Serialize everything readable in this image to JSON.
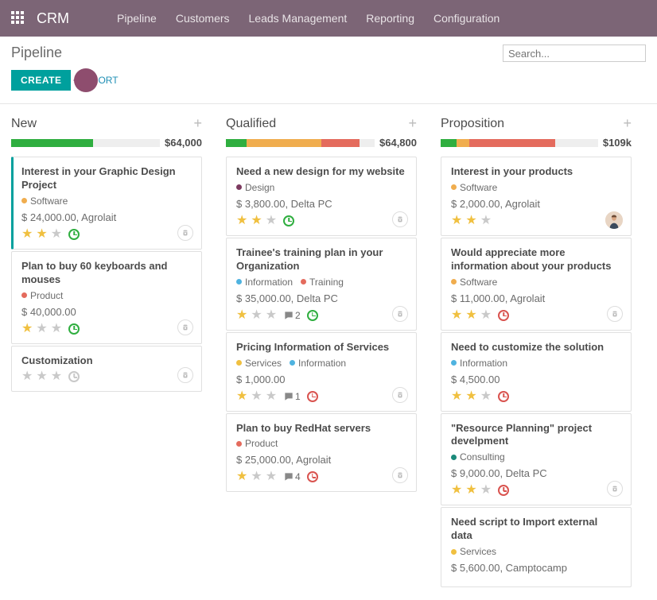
{
  "nav": {
    "brand": "CRM",
    "links": [
      "Pipeline",
      "Customers",
      "Leads Management",
      "Reporting",
      "Configuration"
    ]
  },
  "page": {
    "title": "Pipeline",
    "search_placeholder": "Search..."
  },
  "toolbar": {
    "create_label": "CREATE",
    "import_suffix": "ORT"
  },
  "tag_colors": {
    "Software": "#f0ad4e",
    "Product": "#e46b5d",
    "Design": "#7c3a5f",
    "Information": "#4fb3e0",
    "Training": "#e46b5d",
    "Services": "#f0c040",
    "Consulting": "#1a8a7a"
  },
  "columns": [
    {
      "title": "New",
      "total": "$64,000",
      "segments": [
        {
          "color": "green",
          "pct": 55
        }
      ],
      "cards": [
        {
          "highlight": true,
          "title": "Interest in your Graphic Design Project",
          "tags": [
            "Software"
          ],
          "subtitle": "$ 24,000.00, Agrolait",
          "stars": 2,
          "clock": "green",
          "icon": "attach"
        },
        {
          "title": "Plan to buy 60 keyboards and mouses",
          "tags": [
            "Product"
          ],
          "subtitle": "$ 40,000.00",
          "stars": 1,
          "clock": "green",
          "icon": "attach"
        },
        {
          "title": "Customization",
          "tags": [],
          "subtitle": "",
          "stars": 0,
          "clock": "grey",
          "icon": "attach"
        }
      ]
    },
    {
      "title": "Qualified",
      "total": "$64,800",
      "segments": [
        {
          "color": "green",
          "pct": 14
        },
        {
          "color": "orange",
          "pct": 50
        },
        {
          "color": "red",
          "pct": 26
        }
      ],
      "cards": [
        {
          "title": "Need a new design for my website",
          "tags": [
            "Design"
          ],
          "subtitle": "$ 3,800.00, Delta PC",
          "stars": 2,
          "clock": "green",
          "icon": "attach"
        },
        {
          "title": "Trainee's training plan in your Organization",
          "tags": [
            "Information",
            "Training"
          ],
          "subtitle": "$ 35,000.00, Delta PC",
          "stars": 1,
          "msg": 2,
          "clock": "green",
          "icon": "attach"
        },
        {
          "title": "Pricing Information of Services",
          "tags": [
            "Services",
            "Information"
          ],
          "subtitle": "$ 1,000.00",
          "stars": 1,
          "msg": 1,
          "clock": "red",
          "icon": "attach"
        },
        {
          "title": "Plan to buy RedHat servers",
          "tags": [
            "Product"
          ],
          "subtitle": "$ 25,000.00, Agrolait",
          "stars": 1,
          "msg": 4,
          "clock": "red",
          "icon": "attach"
        }
      ]
    },
    {
      "title": "Proposition",
      "total": "$109k",
      "segments": [
        {
          "color": "green",
          "pct": 10
        },
        {
          "color": "orange",
          "pct": 8
        },
        {
          "color": "red",
          "pct": 55
        }
      ],
      "cards": [
        {
          "title": "Interest in your products",
          "tags": [
            "Software"
          ],
          "subtitle": "$ 2,000.00, Agrolait",
          "stars": 2,
          "icon": "avatar"
        },
        {
          "title": "Would appreciate more information about your products",
          "tags": [
            "Software"
          ],
          "subtitle": "$ 11,000.00, Agrolait",
          "stars": 2,
          "clock": "red",
          "icon": "attach"
        },
        {
          "title": "Need to customize the solution",
          "tags": [
            "Information"
          ],
          "subtitle": "$ 4,500.00",
          "stars": 2,
          "clock": "red"
        },
        {
          "title": "\"Resource Planning\" project develpment",
          "tags": [
            "Consulting"
          ],
          "subtitle": "$ 9,000.00, Delta PC",
          "stars": 2,
          "clock": "red",
          "icon": "attach"
        },
        {
          "title": "Need script to Import external data",
          "tags": [
            "Services"
          ],
          "subtitle": "$ 5,600.00, Camptocamp"
        }
      ]
    }
  ]
}
